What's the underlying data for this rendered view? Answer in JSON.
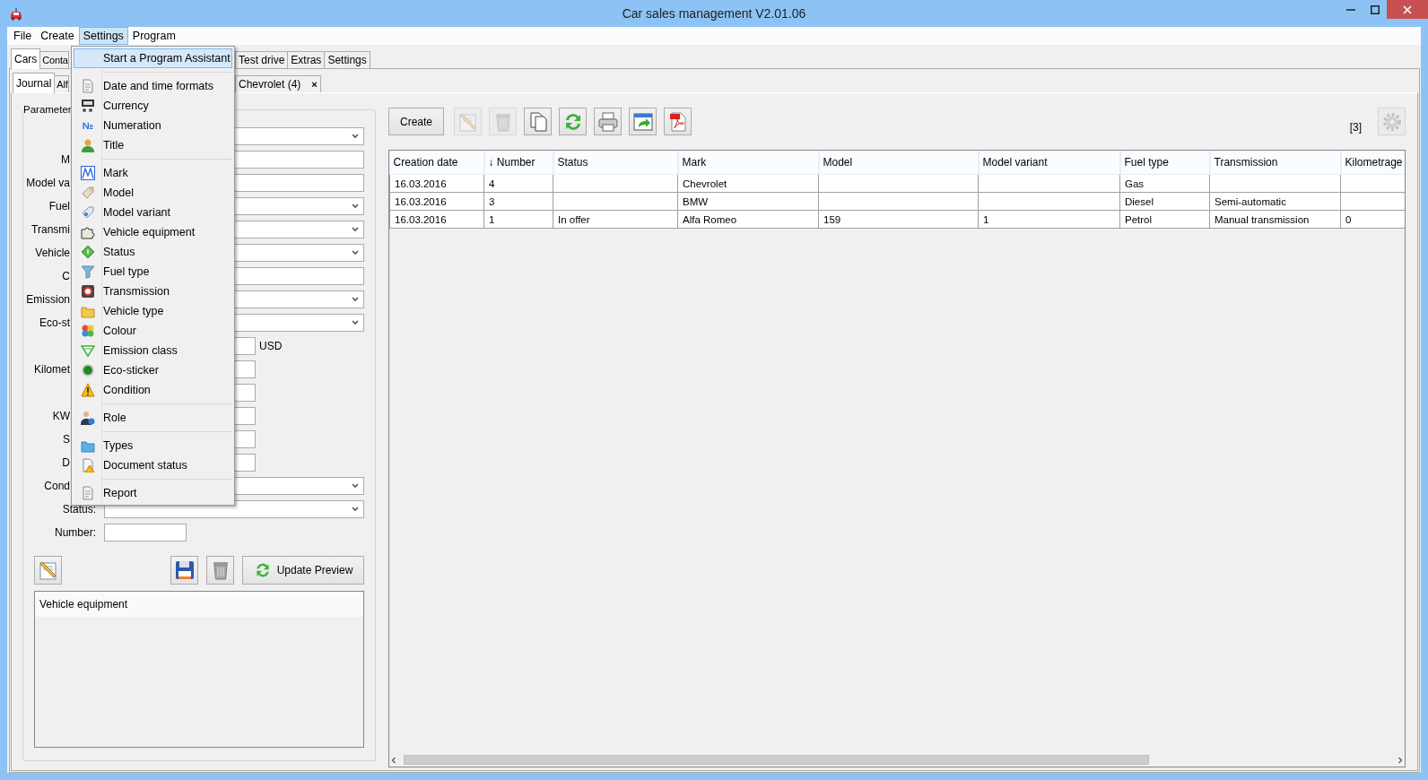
{
  "window": {
    "title": "Car sales management V2.01.06"
  },
  "menu_bar": [
    {
      "label": "File",
      "selected": false
    },
    {
      "label": "Create",
      "selected": false
    },
    {
      "label": "Settings",
      "selected": true
    },
    {
      "label": "Program",
      "selected": false
    }
  ],
  "settings_menu": {
    "items": [
      {
        "kind": "item",
        "label": "Start a Program Assistant",
        "selected": true
      },
      {
        "kind": "separator"
      },
      {
        "kind": "item",
        "label": "Date and time formats",
        "selected": false
      },
      {
        "kind": "item",
        "label": "Currency",
        "selected": false
      },
      {
        "kind": "item",
        "label": "Numeration",
        "selected": false,
        "icon_text": "№"
      },
      {
        "kind": "item",
        "label": "Title",
        "selected": false
      },
      {
        "kind": "separator"
      },
      {
        "kind": "item",
        "label": "Mark",
        "selected": false
      },
      {
        "kind": "item",
        "label": "Model",
        "selected": false
      },
      {
        "kind": "item",
        "label": "Model variant",
        "selected": false
      },
      {
        "kind": "item",
        "label": "Vehicle equipment",
        "selected": false
      },
      {
        "kind": "item",
        "label": "Status",
        "selected": false
      },
      {
        "kind": "item",
        "label": "Fuel type",
        "selected": false
      },
      {
        "kind": "item",
        "label": "Transmission",
        "selected": false
      },
      {
        "kind": "item",
        "label": "Vehicle type",
        "selected": false
      },
      {
        "kind": "item",
        "label": "Colour",
        "selected": false
      },
      {
        "kind": "item",
        "label": "Emission class",
        "selected": false
      },
      {
        "kind": "item",
        "label": "Eco-sticker",
        "selected": false
      },
      {
        "kind": "item",
        "label": "Condition",
        "selected": false
      },
      {
        "kind": "separator"
      },
      {
        "kind": "item",
        "label": "Role",
        "selected": false
      },
      {
        "kind": "separator"
      },
      {
        "kind": "item",
        "label": "Types",
        "selected": false
      },
      {
        "kind": "item",
        "label": "Document status",
        "selected": false
      },
      {
        "kind": "separator"
      },
      {
        "kind": "item",
        "label": "Report",
        "selected": false
      }
    ]
  },
  "main_tabs": [
    {
      "label": "Cars",
      "selected": true
    },
    {
      "label": "Conta",
      "selected": false
    },
    {
      "label": "Test drive",
      "selected": false
    },
    {
      "label": "Extras",
      "selected": false
    },
    {
      "label": "Settings",
      "selected": false
    }
  ],
  "sub_tabs": [
    {
      "label": "Journal",
      "selected": true
    },
    {
      "label": "Alf",
      "selected": false
    },
    {
      "label": "Chevrolet (4)",
      "selected": false,
      "close_icon": "×"
    }
  ],
  "parameters": {
    "title": "Parameter",
    "fields": [
      {
        "kind": "combo"
      },
      {
        "kind": "text",
        "label": "M"
      },
      {
        "kind": "text",
        "label": "Model va"
      },
      {
        "kind": "combo",
        "label": "Fuel"
      },
      {
        "kind": "combo",
        "label": "Transmi"
      },
      {
        "kind": "combo",
        "label": "Vehicle"
      },
      {
        "kind": "text",
        "label": "C"
      },
      {
        "kind": "combo",
        "label": "Emission"
      },
      {
        "kind": "combo",
        "label": "Eco-st"
      },
      {
        "kind": "short",
        "suffix": "USD"
      },
      {
        "kind": "short",
        "label": "Kilomet"
      },
      {
        "kind": "short"
      },
      {
        "kind": "short",
        "label": "KW"
      },
      {
        "kind": "short",
        "label": "S"
      },
      {
        "kind": "short",
        "label": "D"
      },
      {
        "kind": "combo",
        "label": "Cond"
      },
      {
        "kind": "combo",
        "label": "Status:"
      },
      {
        "kind": "narrow",
        "label": "Number:"
      }
    ]
  },
  "form_actions": {
    "update_label": "Update Preview"
  },
  "equipment": {
    "header": "Vehicle equipment"
  },
  "toolbar": {
    "create_label": "Create",
    "icon_buttons": [
      {
        "disabled": true
      },
      {
        "disabled": true
      },
      {
        "disabled": false
      },
      {
        "disabled": false
      },
      {
        "disabled": false
      },
      {
        "disabled": false
      },
      {
        "disabled": false
      }
    ],
    "record_count": "[3]"
  },
  "table": {
    "columns": [
      "Creation date",
      "↓ Number",
      "Status",
      "Mark",
      "Model",
      "Model variant",
      "Fuel type",
      "Transmission",
      "Kilometrage"
    ],
    "rows": [
      [
        "16.03.2016",
        "4",
        null,
        "Chevrolet",
        null,
        null,
        "Gas",
        null,
        null
      ],
      [
        "16.03.2016",
        "3",
        null,
        "BMW",
        null,
        null,
        "Diesel",
        "Semi-automatic",
        null
      ],
      [
        "16.03.2016",
        "1",
        "In offer",
        "Alfa Romeo",
        "159",
        "1",
        "Petrol",
        "Manual transmission",
        "0"
      ]
    ]
  }
}
